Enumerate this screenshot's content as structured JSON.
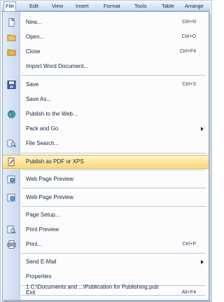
{
  "menubar": {
    "items": [
      "File",
      "Edit",
      "View",
      "Insert",
      "Format",
      "Tools",
      "Table",
      "Arrange"
    ]
  },
  "menu": {
    "new": {
      "label": "New...",
      "shortcut": "Ctrl+N"
    },
    "open": {
      "label": "Open...",
      "shortcut": "Ctrl+O"
    },
    "close": {
      "label": "Close",
      "shortcut": "Ctrl+F4"
    },
    "import_word": {
      "label": "Import Word Document..."
    },
    "save": {
      "label": "Save",
      "shortcut": "Ctrl+S"
    },
    "save_as": {
      "label": "Save As..."
    },
    "publish_web": {
      "label": "Publish to the Web..."
    },
    "pack_and_go": {
      "label": "Pack and Go"
    },
    "file_search": {
      "label": "File Search..."
    },
    "publish_pdf": {
      "label": "Publish as PDF or XPS"
    },
    "web_preview_1": {
      "label": "Web Page Preview"
    },
    "web_preview_2": {
      "label": "Web Page Preview"
    },
    "page_setup": {
      "label": "Page Setup..."
    },
    "print_preview": {
      "label": "Print Preview"
    },
    "print": {
      "label": "Print...",
      "shortcut": "Ctrl+P"
    },
    "send_email": {
      "label": "Send E-Mail"
    },
    "properties": {
      "label": "Properties"
    },
    "recent_file": {
      "label": "1 C:\\Documents and ...\\Publication for Publishing.pub"
    },
    "exit": {
      "label": "Exit",
      "shortcut": "Alt+F4"
    }
  },
  "colors": {
    "highlight": "#fbd97a",
    "gutter": "#c8d8ee",
    "menubar": "#c7d8ef"
  }
}
